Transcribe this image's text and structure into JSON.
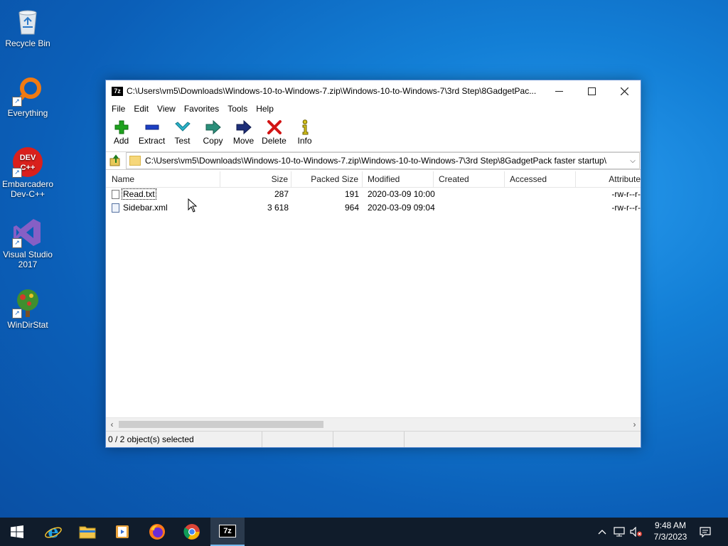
{
  "desktop": {
    "icons": [
      {
        "label": "Recycle Bin",
        "icon": "recycle-bin-icon"
      },
      {
        "label": "Everything",
        "icon": "everything-search-icon"
      },
      {
        "label": "Embarcadero Dev-C++",
        "icon": "devcpp-icon",
        "badge_text": "DEV C++"
      },
      {
        "label": "Visual Studio 2017",
        "icon": "visual-studio-icon"
      },
      {
        "label": "WinDirStat",
        "icon": "windirstat-icon"
      }
    ]
  },
  "window": {
    "app_badge": "7z",
    "title": "C:\\Users\\vm5\\Downloads\\Windows-10-to-Windows-7.zip\\Windows-10-to-Windows-7\\3rd Step\\8GadgetPac...",
    "menu": [
      "File",
      "Edit",
      "View",
      "Favorites",
      "Tools",
      "Help"
    ],
    "toolbar": [
      {
        "label": "Add",
        "icon": "plus-icon",
        "color": "#1fa21f"
      },
      {
        "label": "Extract",
        "icon": "minus-icon",
        "color": "#1c3fc4"
      },
      {
        "label": "Test",
        "icon": "checkmark-icon",
        "color": "#2bb3c9"
      },
      {
        "label": "Copy",
        "icon": "copy-arrow-icon",
        "color": "#2a8f7a"
      },
      {
        "label": "Move",
        "icon": "move-arrow-icon",
        "color": "#1e2f7a"
      },
      {
        "label": "Delete",
        "icon": "delete-x-icon",
        "color": "#d21414"
      },
      {
        "label": "Info",
        "icon": "info-icon",
        "color": "#d4c21a"
      }
    ],
    "address": "C:\\Users\\vm5\\Downloads\\Windows-10-to-Windows-7.zip\\Windows-10-to-Windows-7\\3rd Step\\8GadgetPack faster startup\\",
    "columns": [
      "Name",
      "Size",
      "Packed Size",
      "Modified",
      "Created",
      "Accessed",
      "Attribute"
    ],
    "files": [
      {
        "name": "Read.txt",
        "size": "287",
        "packed": "191",
        "modified": "2020-03-09 10:00",
        "created": "",
        "accessed": "",
        "attributes": "-rw-r--r-"
      },
      {
        "name": "Sidebar.xml",
        "size": "3 618",
        "packed": "964",
        "modified": "2020-03-09 09:04",
        "created": "",
        "accessed": "",
        "attributes": "-rw-r--r-"
      }
    ],
    "status": "0 / 2 object(s) selected"
  },
  "taskbar": {
    "apps": [
      "start-windows-icon",
      "internet-explorer-icon",
      "file-explorer-icon",
      "media-player-icon",
      "firefox-icon",
      "chrome-icon",
      "7zip-icon"
    ],
    "active_badge": "7z",
    "clock_time": "9:48 AM",
    "clock_date": "7/3/2023"
  }
}
